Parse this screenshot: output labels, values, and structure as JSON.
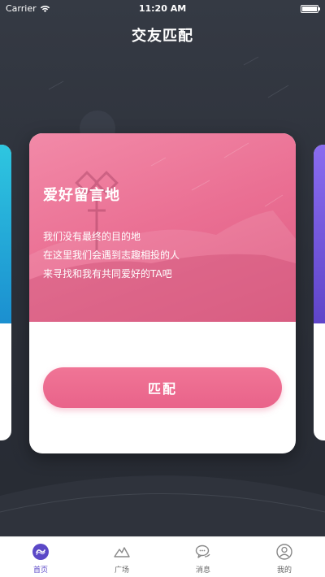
{
  "status_bar": {
    "carrier": "Carrier",
    "time": "11:20 AM"
  },
  "header": {
    "title": "交友匹配"
  },
  "card": {
    "title": "爱好留言地",
    "lines": [
      "我们没有最终的目的地",
      "在这里我们会遇到志趣相投的人",
      "来寻找和我有共同爱好的TA吧"
    ],
    "button_label": "匹配"
  },
  "tabs": [
    {
      "label": "首页",
      "icon": "home-swirl-icon",
      "active": true
    },
    {
      "label": "广场",
      "icon": "mountain-icon",
      "active": false
    },
    {
      "label": "消息",
      "icon": "chat-bubbles-icon",
      "active": false
    },
    {
      "label": "我的",
      "icon": "user-icon",
      "active": false
    }
  ],
  "colors": {
    "card_accent": "#ea6f93",
    "tab_active": "#5b48c7",
    "left_card": "#1b8fd0",
    "right_card": "#6a4fd6"
  }
}
